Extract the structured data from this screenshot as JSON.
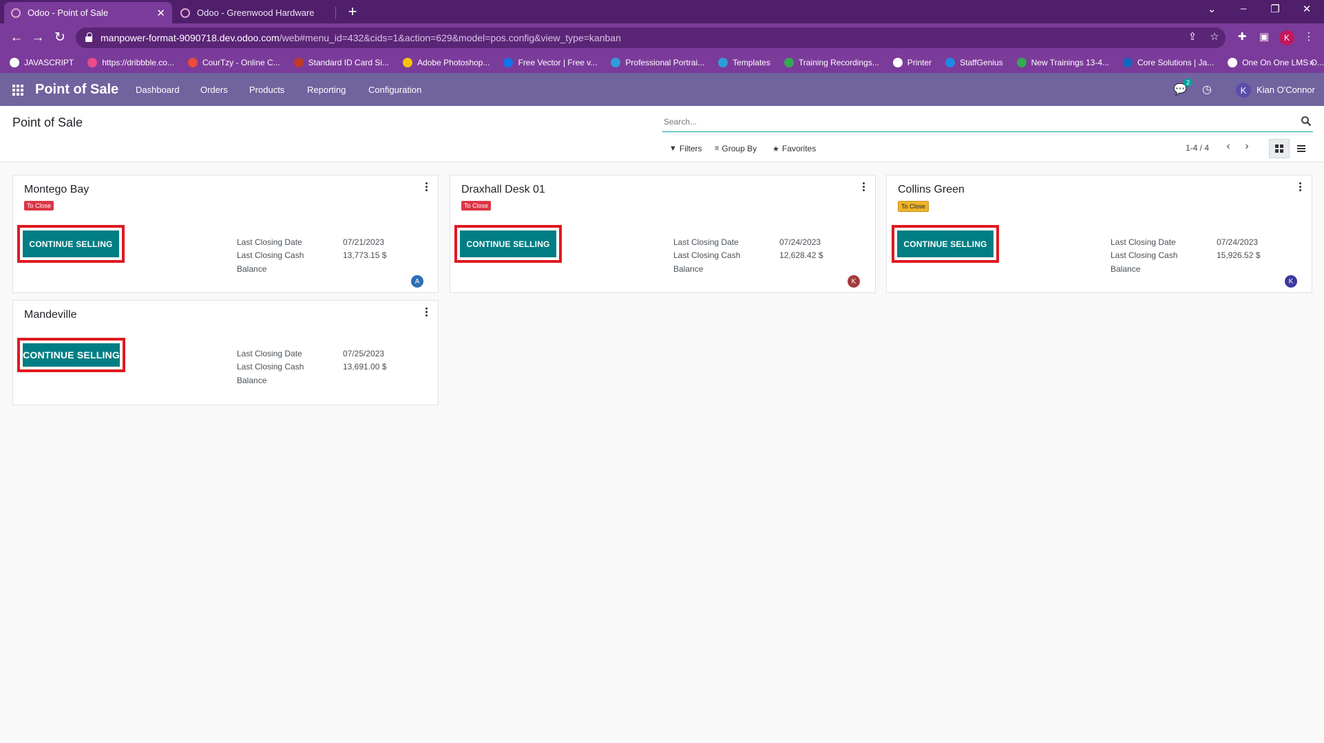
{
  "browser": {
    "tabs": [
      {
        "title": "Odoo - Point of Sale",
        "active": true
      },
      {
        "title": "Odoo - Greenwood Hardware",
        "active": false
      }
    ],
    "url_host": "manpower-format-9090718.dev.odoo.com",
    "url_path": "/web#menu_id=432&cids=1&action=629&model=pos.config&view_type=kanban",
    "profile_initial": "K",
    "bookmarks": [
      {
        "label": "JAVASCRIPT",
        "color": "#ffffff"
      },
      {
        "label": "https://dribbble.co...",
        "color": "#ea4c89"
      },
      {
        "label": "CourTzy - Online C...",
        "color": "#e94b3c"
      },
      {
        "label": "Standard ID Card Si...",
        "color": "#c0392b"
      },
      {
        "label": "Adobe Photoshop...",
        "color": "#f4c20d"
      },
      {
        "label": "Free Vector | Free v...",
        "color": "#1273eb"
      },
      {
        "label": "Professional Portrai...",
        "color": "#2d9cdb"
      },
      {
        "label": "Templates",
        "color": "#2d9cdb"
      },
      {
        "label": "Training Recordings...",
        "color": "#34a853"
      },
      {
        "label": "Printer",
        "color": "#ffffff"
      },
      {
        "label": "StaffGenius",
        "color": "#1e88e5"
      },
      {
        "label": "New Trainings 13-4...",
        "color": "#34a853"
      },
      {
        "label": "Core Solutions | Ja...",
        "color": "#1565c0"
      },
      {
        "label": "One On One LMS O...",
        "color": "#ffffff"
      }
    ]
  },
  "odoo_nav": {
    "app_name": "Point of Sale",
    "menu": [
      "Dashboard",
      "Orders",
      "Products",
      "Reporting",
      "Configuration"
    ],
    "chat_count": "2",
    "user_initial": "K",
    "user_name": "Kian O'Connor",
    "colors": {
      "navbar": "#71639e",
      "primary": "#017e84"
    }
  },
  "control_panel": {
    "breadcrumb": "Point of Sale",
    "search_placeholder": "Search...",
    "filters_label": "Filters",
    "groupby_label": "Group By",
    "favorites_label": "Favorites",
    "pager_value": "1-4 / 4"
  },
  "cards": [
    {
      "name": "Montego Bay",
      "status": "To Close",
      "status_color": "red",
      "button_label": "CONTINUE SELLING",
      "labels": [
        "Last Closing Date",
        "Last Closing Cash",
        "Balance"
      ],
      "last_closing_date": "07/21/2023",
      "last_closing_cash": "13,773.15 $",
      "avatar_initial": "A",
      "avatar_color": "#2f6eb5"
    },
    {
      "name": "Draxhall Desk 01",
      "status": "To Close",
      "status_color": "red",
      "button_label": "CONTINUE SELLING",
      "labels": [
        "Last Closing Date",
        "Last Closing Cash",
        "Balance"
      ],
      "last_closing_date": "07/24/2023",
      "last_closing_cash": "12,628.42 $",
      "avatar_initial": "K",
      "avatar_color": "#a33a3a"
    },
    {
      "name": "Collins Green",
      "status": "To Close",
      "status_color": "yellow",
      "button_label": "CONTINUE SELLING",
      "labels": [
        "Last Closing Date",
        "Last Closing Cash",
        "Balance"
      ],
      "last_closing_date": "07/24/2023",
      "last_closing_cash": "15,926.52 $",
      "avatar_initial": "K",
      "avatar_color": "#3b3a9e"
    },
    {
      "name": "Mandeville",
      "button_label": "CONTINUE SELLING",
      "labels": [
        "Last Closing Date",
        "Last Closing Cash",
        "Balance"
      ],
      "last_closing_date": "07/25/2023",
      "last_closing_cash": "13,691.00 $"
    }
  ]
}
